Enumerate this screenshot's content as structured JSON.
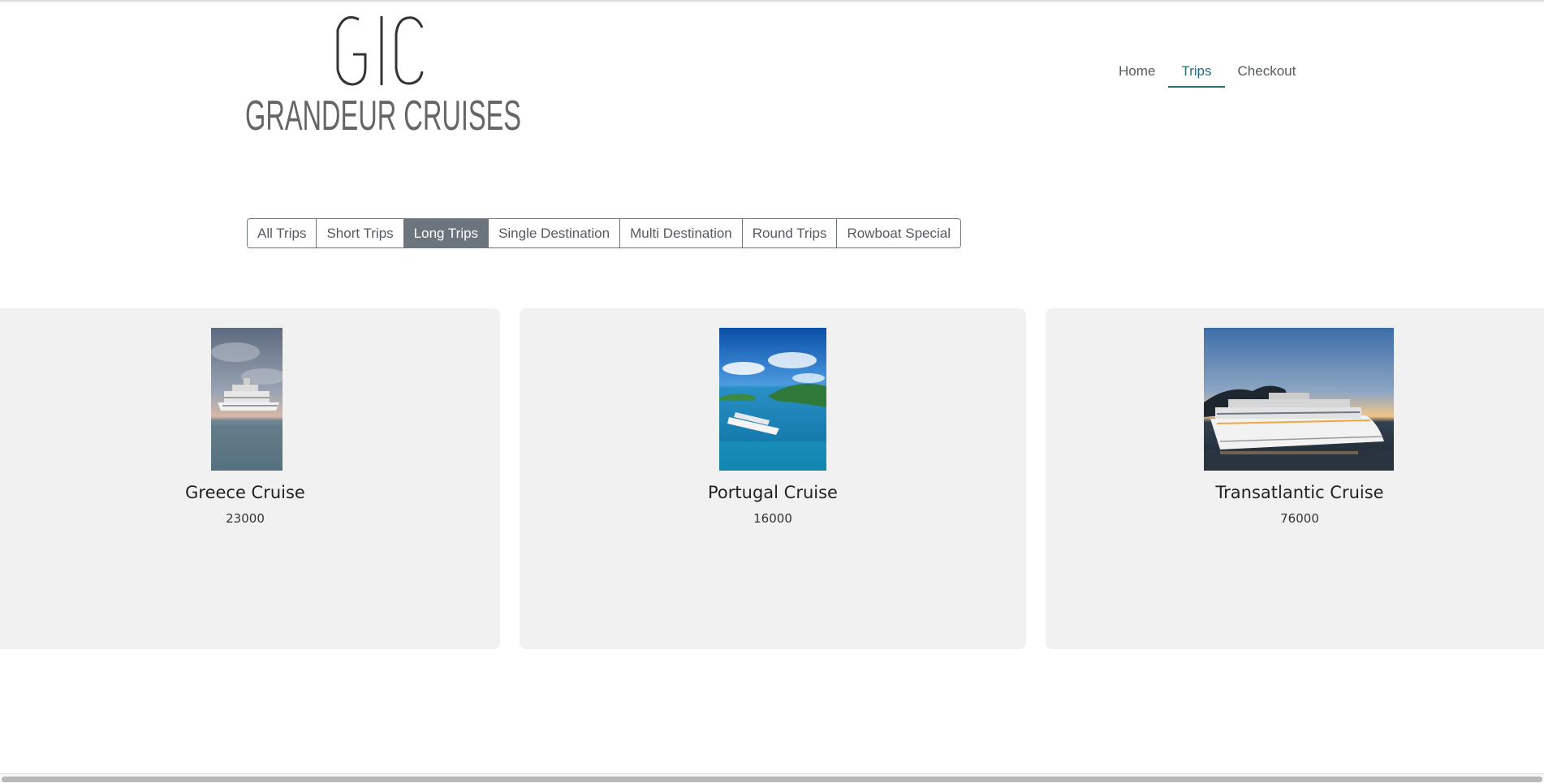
{
  "logo": {
    "mark": "G|C",
    "name": "GRANDEUR CRUISES"
  },
  "nav": {
    "items": [
      {
        "label": "Home"
      },
      {
        "label": "Trips",
        "active": true
      },
      {
        "label": "Checkout"
      }
    ]
  },
  "filters": {
    "items": [
      {
        "label": "All Trips"
      },
      {
        "label": "Short Trips"
      },
      {
        "label": "Long Trips",
        "active": true
      },
      {
        "label": "Single Destination"
      },
      {
        "label": "Multi Destination"
      },
      {
        "label": "Round Trips"
      },
      {
        "label": "Rowboat Special"
      }
    ]
  },
  "trips": [
    {
      "name": "Greece Cruise",
      "price": "23000"
    },
    {
      "name": "Portugal Cruise",
      "price": "16000"
    },
    {
      "name": "Transatlantic Cruise",
      "price": "76000"
    }
  ],
  "colors": {
    "accent": "#2e6b78",
    "active_filter": "#6c757d",
    "card_bg": "#f1f1f1"
  }
}
